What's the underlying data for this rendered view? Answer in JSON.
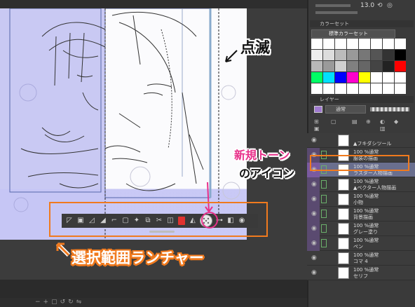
{
  "annotations": {
    "blink": "点滅",
    "new_tone_line1": "新規トーン",
    "new_tone_line2": "のアイコン",
    "selection_launcher": "選択範囲ランチャー"
  },
  "navigator": {
    "zoom": "13.0"
  },
  "color_set": {
    "header": "カラーセット",
    "selected_set": "標準カラーセット",
    "swatches": [
      "#ffffff",
      "#ffffff",
      "#ffffff",
      "#ffffff",
      "#ffffff",
      "#ffffff",
      "#ffffff",
      "#ffffff",
      "#eeeeee",
      "#dddddd",
      "#bbbbbb",
      "#999999",
      "#777777",
      "#555555",
      "#333333",
      "#000000",
      "#b8b8b8",
      "#9a9a9a",
      "#d0d0d0",
      "#808080",
      "#666666",
      "#444444",
      "#222222",
      "#ff0000",
      "#00ff66",
      "#00e0ff",
      "#0000ff",
      "#ff00cc",
      "#ffff00",
      "#ffffff",
      "#ffffff",
      "#ffffff",
      "#ffffff",
      "#ffffff",
      "#ffffff",
      "#ffffff",
      "#ffffff",
      "#ffffff",
      "#ffffff",
      "#ffffff"
    ]
  },
  "layers_panel": {
    "header": "レイヤー",
    "blend_mode": "通常",
    "layers": [
      {
        "mode": "",
        "name": "▲フキダシツール",
        "selected": false
      },
      {
        "mode": "100 %通常",
        "name": "服装の描画",
        "selected": false
      },
      {
        "mode": "100 %通常",
        "name": "ラスター人物描画",
        "selected": true
      },
      {
        "mode": "100 %通常",
        "name": "▲ベクター人物描画",
        "selected": false
      },
      {
        "mode": "100 %通常",
        "name": "小物",
        "selected": false
      },
      {
        "mode": "100 %通常",
        "name": "背景描画",
        "selected": false
      },
      {
        "mode": "100 %通常",
        "name": "グレー塗り",
        "selected": false
      },
      {
        "mode": "100 %通常",
        "name": "ペン",
        "selected": false
      },
      {
        "mode": "100 %通常",
        "name": "コマ 4",
        "selected": false
      },
      {
        "mode": "100 %通常",
        "name": "セリフ",
        "selected": false
      }
    ]
  },
  "launcher_icons": [
    "deselect-icon",
    "invert-icon",
    "expand-icon",
    "shrink-icon",
    "crop-icon",
    "clear-icon",
    "transform-icon",
    "copy-icon",
    "cut-paste-icon",
    "fill-icon",
    "new-layer-icon",
    "new-tone-icon",
    "mask-icon",
    "border-icon",
    "settings-icon"
  ]
}
